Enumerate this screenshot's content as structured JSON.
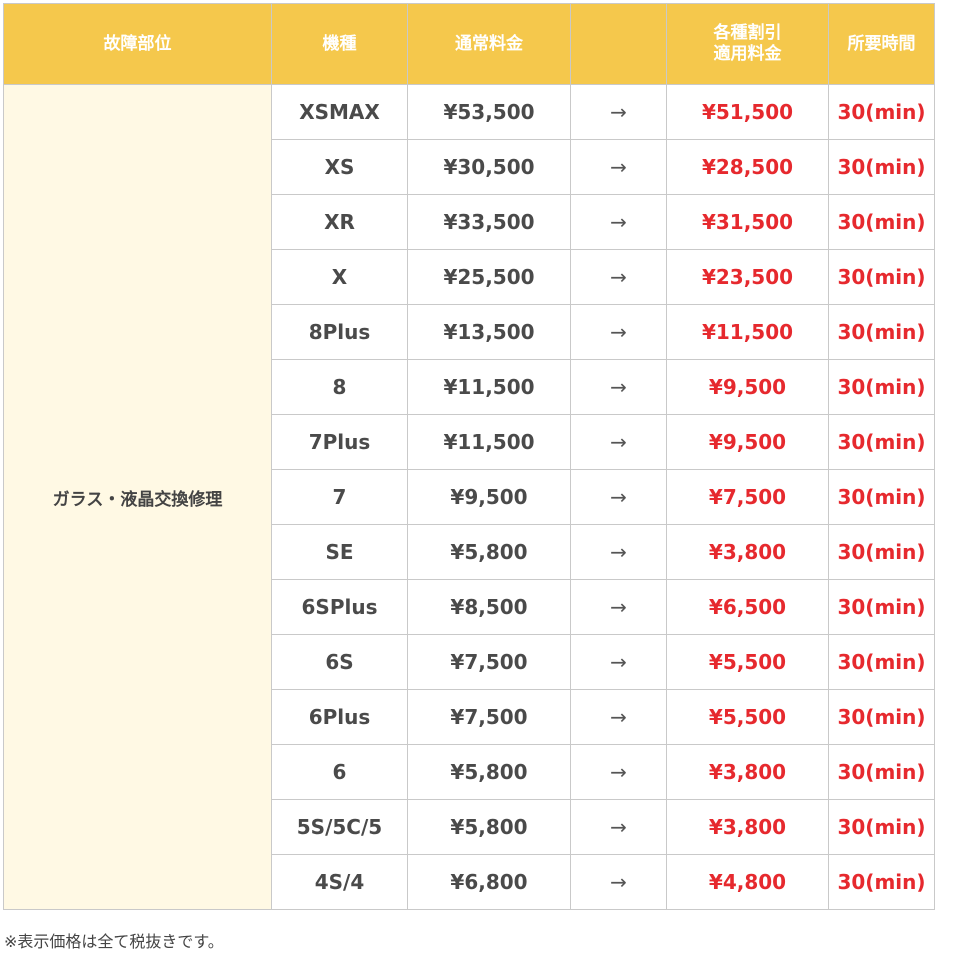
{
  "headers": {
    "part": "故障部位",
    "model": "機種",
    "normal_price": "通常料金",
    "discount_line1": "各種割引",
    "discount_line2": "適用料金",
    "time": "所要時間"
  },
  "part_label": "ガラス・液晶交換修理",
  "arrow": "→",
  "rows": [
    {
      "model": "XSMAX",
      "normal": "¥53,500",
      "discount": "¥51,500",
      "time": "30(min)"
    },
    {
      "model": "XS",
      "normal": "¥30,500",
      "discount": "¥28,500",
      "time": "30(min)"
    },
    {
      "model": "XR",
      "normal": "¥33,500",
      "discount": "¥31,500",
      "time": "30(min)"
    },
    {
      "model": "X",
      "normal": "¥25,500",
      "discount": "¥23,500",
      "time": "30(min)"
    },
    {
      "model": "8Plus",
      "normal": "¥13,500",
      "discount": "¥11,500",
      "time": "30(min)"
    },
    {
      "model": "8",
      "normal": "¥11,500",
      "discount": "¥9,500",
      "time": "30(min)"
    },
    {
      "model": "7Plus",
      "normal": "¥11,500",
      "discount": "¥9,500",
      "time": "30(min)"
    },
    {
      "model": "7",
      "normal": "¥9,500",
      "discount": "¥7,500",
      "time": "30(min)"
    },
    {
      "model": "SE",
      "normal": "¥5,800",
      "discount": "¥3,800",
      "time": "30(min)"
    },
    {
      "model": "6SPlus",
      "normal": "¥8,500",
      "discount": "¥6,500",
      "time": "30(min)"
    },
    {
      "model": "6S",
      "normal": "¥7,500",
      "discount": "¥5,500",
      "time": "30(min)"
    },
    {
      "model": "6Plus",
      "normal": "¥7,500",
      "discount": "¥5,500",
      "time": "30(min)"
    },
    {
      "model": "6",
      "normal": "¥5,800",
      "discount": "¥3,800",
      "time": "30(min)"
    },
    {
      "model": "5S/5C/5",
      "normal": "¥5,800",
      "discount": "¥3,800",
      "time": "30(min)"
    },
    {
      "model": "4S/4",
      "normal": "¥6,800",
      "discount": "¥4,800",
      "time": "30(min)"
    }
  ],
  "footnote": "※表示価格は全て税抜きです。",
  "colors": {
    "header_bg": "#f5c84c",
    "part_cell_bg": "#fff9e4",
    "discount_text": "#e6292e",
    "border": "#c9c9c9"
  }
}
